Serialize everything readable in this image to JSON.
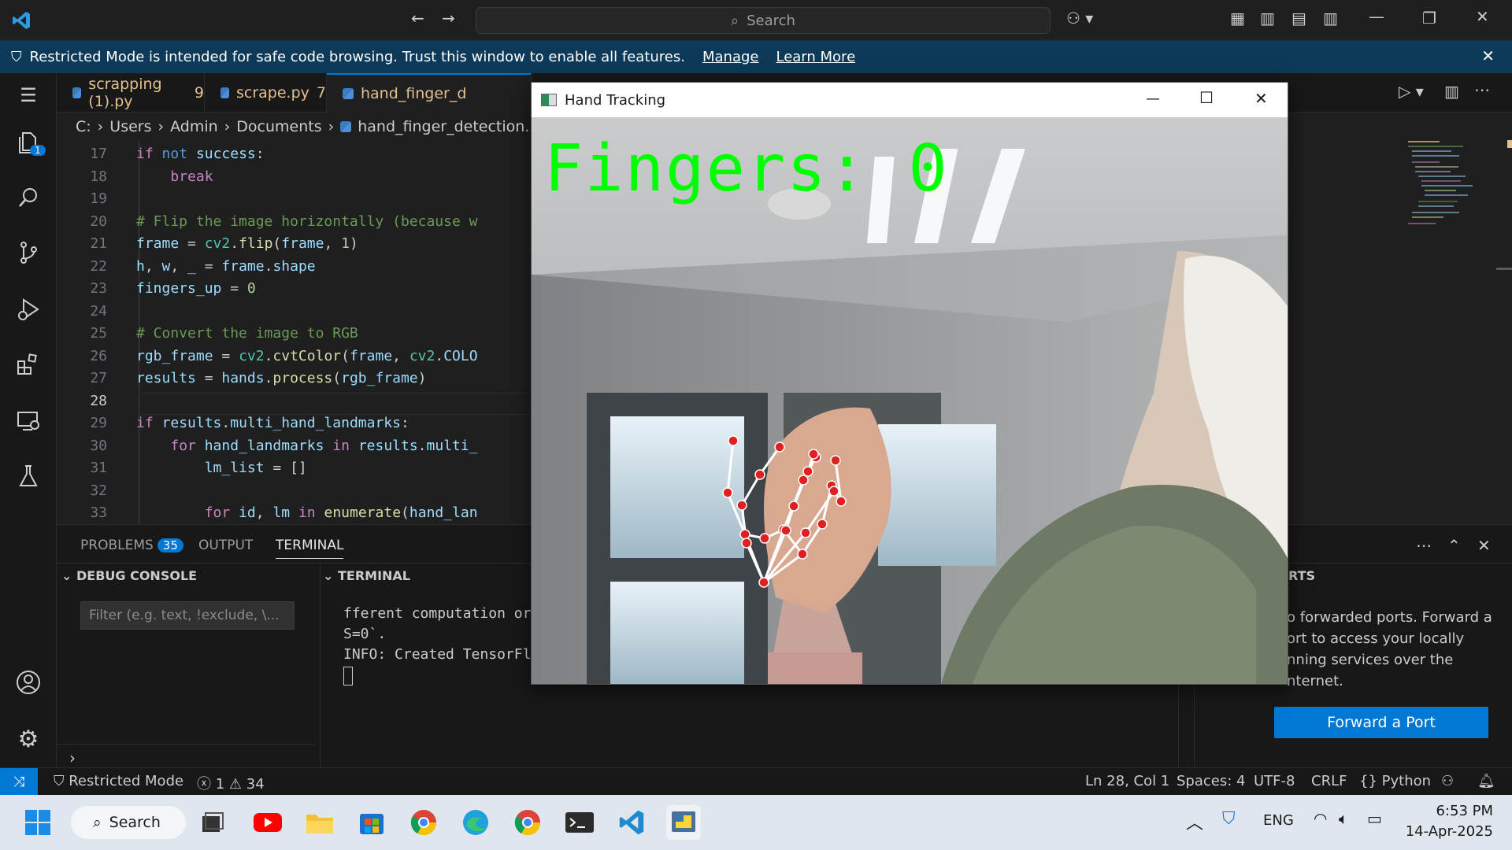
{
  "titlebar": {
    "search_placeholder": "Search",
    "icons": [
      "vscode-logo",
      "back-arrow",
      "forward-arrow",
      "copilot-icon",
      "layout-icons",
      "minimize",
      "restore",
      "close"
    ]
  },
  "banner": {
    "message": "Restricted Mode is intended for safe code browsing. Trust this window to enable all features.",
    "manage": "Manage",
    "learn_more": "Learn More"
  },
  "activity": {
    "explorer_badge": "1"
  },
  "tabs": [
    {
      "label": "scrapping (1).py",
      "count": "9"
    },
    {
      "label": "scrape.py",
      "count": "7"
    },
    {
      "label": "hand_finger_d"
    }
  ],
  "breadcrumb": [
    "C:",
    "Users",
    "Admin",
    "Documents",
    "hand_finger_detection.py"
  ],
  "editor": {
    "line_numbers": [
      "17",
      "18",
      "19",
      "20",
      "21",
      "22",
      "23",
      "24",
      "25",
      "26",
      "27",
      "28",
      "29",
      "30",
      "31",
      "32",
      "33"
    ]
  },
  "panel": {
    "problems_label": "PROBLEMS",
    "problems_count": "35",
    "output_label": "OUTPUT",
    "terminal_label": "TERMINAL",
    "debug_console": "DEBUG CONSOLE",
    "terminal_section": "TERMINAL",
    "ports_section": "RTS",
    "filter_placeholder": "Filter (e.g. text, !exclude, \\...",
    "terminal_lines": [
      "fferent computation or",
      "S=0`.",
      "INFO: Created TensorFl"
    ],
    "ports_text": [
      "o forwarded ports. Forward a",
      "ort to access your locally",
      "nning services over the",
      "nternet."
    ],
    "forward_button": "Forward a Port"
  },
  "status": {
    "restricted": "Restricted Mode",
    "errors": "1",
    "warnings": "34",
    "position": "Ln 28, Col 1",
    "spaces": "Spaces: 4",
    "encoding": "UTF-8",
    "eol": "CRLF",
    "language": "Python"
  },
  "hand_window": {
    "title": "Hand Tracking",
    "overlay_text": "Fingers: 0"
  },
  "taskbar": {
    "search": "Search",
    "lang": "ENG",
    "time": "6:53 PM",
    "date": "14-Apr-2025"
  }
}
